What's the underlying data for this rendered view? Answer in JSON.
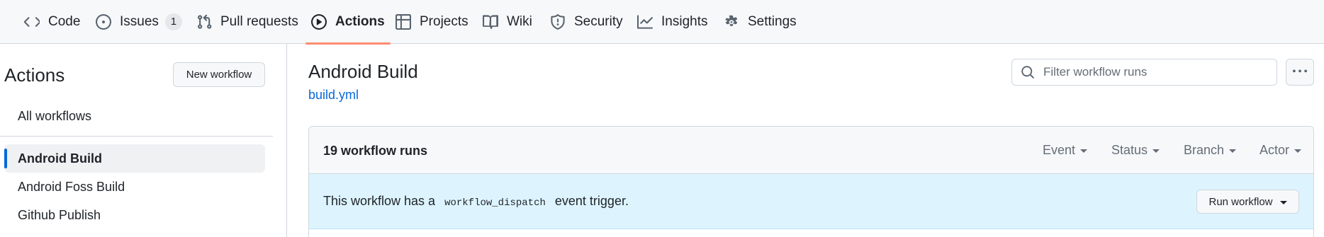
{
  "nav": {
    "tabs": [
      {
        "label": "Code",
        "icon": "code-icon"
      },
      {
        "label": "Issues",
        "icon": "issue-icon",
        "count": "1"
      },
      {
        "label": "Pull requests",
        "icon": "pull-request-icon"
      },
      {
        "label": "Actions",
        "icon": "play-icon",
        "active": true
      },
      {
        "label": "Projects",
        "icon": "table-icon"
      },
      {
        "label": "Wiki",
        "icon": "book-icon"
      },
      {
        "label": "Security",
        "icon": "shield-icon"
      },
      {
        "label": "Insights",
        "icon": "graph-icon"
      },
      {
        "label": "Settings",
        "icon": "gear-icon"
      }
    ]
  },
  "sidebar": {
    "title": "Actions",
    "new_workflow_label": "New workflow",
    "all_workflows_label": "All workflows",
    "workflows": [
      {
        "label": "Android Build",
        "selected": true
      },
      {
        "label": "Android Foss Build"
      },
      {
        "label": "Github Publish"
      }
    ]
  },
  "main": {
    "workflow_title": "Android Build",
    "workflow_file": "build.yml",
    "filter_placeholder": "Filter workflow runs",
    "runs_count": "19 workflow runs",
    "filters": [
      "Event",
      "Status",
      "Branch",
      "Actor"
    ],
    "dispatch": {
      "text_before": "This workflow has a ",
      "code": "workflow_dispatch",
      "text_after": " event trigger.",
      "button_label": "Run workflow"
    }
  },
  "colors": {
    "accent": "#0969da",
    "active_tab_underline": "#fd8c73",
    "dispatch_bg": "#ddf4ff"
  }
}
